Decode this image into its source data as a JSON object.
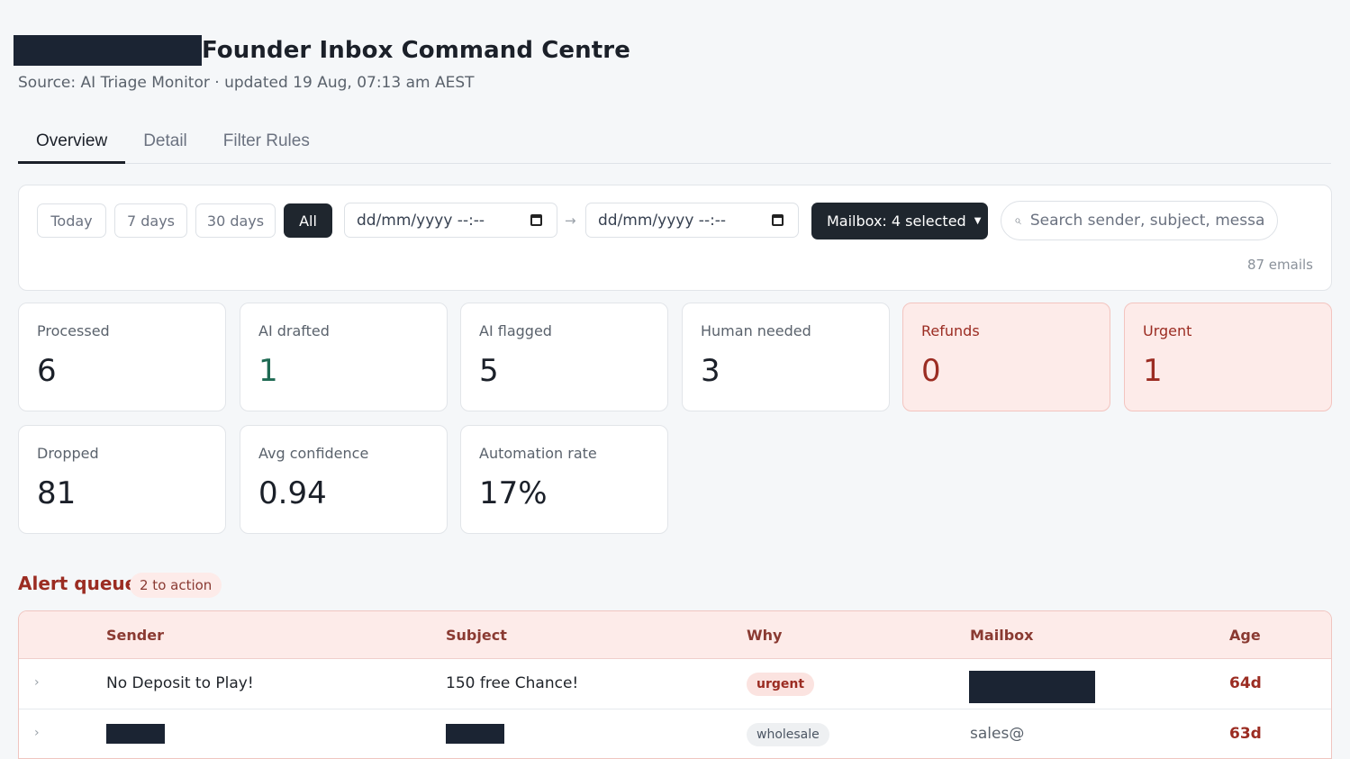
{
  "header": {
    "title": "Founder Inbox Command Centre",
    "subtitle": "Source: AI Triage Monitor · updated 19 Aug, 07:13 am AEST"
  },
  "tabs": [
    {
      "label": "Overview",
      "active": true
    },
    {
      "label": "Detail",
      "active": false
    },
    {
      "label": "Filter Rules",
      "active": false
    }
  ],
  "filters": {
    "ranges": [
      {
        "label": "Today",
        "active": false
      },
      {
        "label": "7 days",
        "active": false
      },
      {
        "label": "30 days",
        "active": false
      },
      {
        "label": "All",
        "active": true
      }
    ],
    "date_from_placeholder": "dd/mm/yyyy --:--",
    "date_to_placeholder": "dd/mm/yyyy --:--",
    "arrow": "→",
    "mailbox_label": "Mailbox: 4 selected",
    "search_placeholder": "Search sender, subject, message",
    "email_count": "87 emails"
  },
  "metrics": [
    {
      "label": "Processed",
      "value": "6"
    },
    {
      "label": "AI drafted",
      "value": "1"
    },
    {
      "label": "AI flagged",
      "value": "5"
    },
    {
      "label": "Human needed",
      "value": "3"
    },
    {
      "label": "Refunds",
      "value": "0"
    },
    {
      "label": "Urgent",
      "value": "1"
    },
    {
      "label": "Dropped",
      "value": "81"
    },
    {
      "label": "Avg confidence",
      "value": "0.94"
    },
    {
      "label": "Automation rate",
      "value": "17%"
    }
  ],
  "alert_queue": {
    "title": "Alert queue",
    "badge": "2 to action",
    "columns": [
      "Sender",
      "Subject",
      "Why",
      "Mailbox",
      "Age"
    ],
    "rows": [
      {
        "sender": "No Deposit to Play!",
        "subject": "150 free Chance!",
        "why": "urgent",
        "mailbox": "",
        "age": "64d"
      },
      {
        "sender": "",
        "subject": "",
        "why": "wholesale",
        "mailbox": "sales@",
        "age": "63d"
      }
    ]
  },
  "colors": {
    "accent_dark": "#1f262e",
    "alert_red": "#9b2c22",
    "alert_bg": "#fdebe9",
    "positive_green": "#1f6a53"
  }
}
